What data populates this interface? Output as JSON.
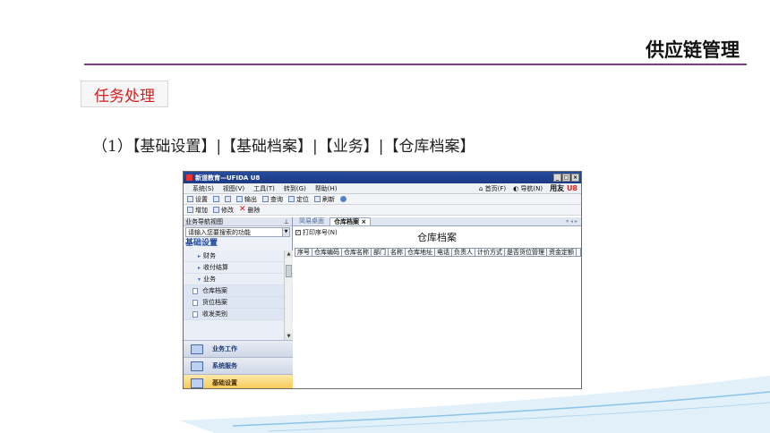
{
  "slide": {
    "title": "供应链管理",
    "task_label": "任务处理",
    "step_text": "（1）【基础设置】|【基础档案】|【业务】|【仓库档案】"
  },
  "window": {
    "title": "新道教育—UFIDA U8",
    "controls": [
      "_",
      "□",
      "×"
    ],
    "menus": [
      "系统(S)",
      "视图(V)",
      "工具(T)",
      "转到(G)",
      "帮助(H)"
    ],
    "menu_right": {
      "home": "首页(F)",
      "navigate": "导航(N)",
      "brand_a": "用友",
      "brand_b": "U8"
    },
    "toolbar": [
      {
        "label": "设置",
        "icon": "settings-icon"
      },
      {
        "label": "",
        "icon": "print-icon"
      },
      {
        "label": "",
        "icon": "preview-icon"
      },
      {
        "label": "输出",
        "icon": "export-icon"
      },
      {
        "label": "查询",
        "icon": "binoculars-icon"
      },
      {
        "label": "定位",
        "icon": "locate-icon"
      },
      {
        "label": "刷新",
        "icon": "refresh-icon"
      },
      {
        "label": "",
        "icon": "help-icon"
      }
    ],
    "toolbar2": [
      {
        "label": "增加",
        "icon": "add-icon"
      },
      {
        "label": "修改",
        "icon": "edit-icon"
      },
      {
        "label": "删除",
        "icon": "delete-icon"
      }
    ],
    "nav": {
      "header": "业务导航视图",
      "pin": "ꝑ",
      "search_placeholder": "请输入您要搜索的功能",
      "section": "基础设置",
      "tree": [
        {
          "label": "财务",
          "arrow": "▸",
          "type": "node"
        },
        {
          "label": "收付结算",
          "arrow": "▸",
          "type": "node"
        },
        {
          "label": "业务",
          "arrow": "▾",
          "type": "node"
        },
        {
          "label": "仓库档案",
          "type": "leaf"
        },
        {
          "label": "货位档案",
          "type": "leaf"
        },
        {
          "label": "收发类别",
          "type": "leaf"
        }
      ],
      "groups": [
        {
          "label": "业务工作",
          "active": false
        },
        {
          "label": "系统服务",
          "active": false
        },
        {
          "label": "基础设置",
          "active": true
        }
      ]
    },
    "tabs": [
      {
        "label": "简易桌面",
        "active": false
      },
      {
        "label": "仓库档案 ×",
        "active": true
      }
    ],
    "tab_arrows": "▾ ◂ ▸",
    "print_seq": "打印序号(N)",
    "doc_title": "仓库档案",
    "columns": [
      "序号",
      "仓库编码",
      "仓库名称",
      "部门",
      "名称",
      "仓库地址",
      "电话",
      "负责人",
      "计价方式",
      "是否货位管理",
      "资金定额"
    ]
  }
}
